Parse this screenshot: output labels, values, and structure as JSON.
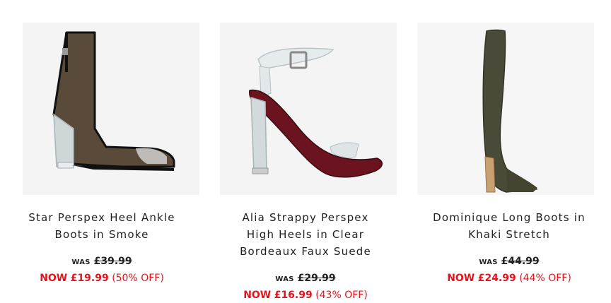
{
  "products": [
    {
      "title": "Star Perspex Heel Ankle Boots in Smoke",
      "was_label": "WAS",
      "was_price": "£39.99",
      "now_label": "NOW",
      "now_price": "£19.99",
      "discount": "(50% OFF)",
      "image_icon": "smoke-perspex-ankle-boot"
    },
    {
      "title": "Alia Strappy Perspex High Heels in Clear Bordeaux Faux Suede",
      "was_label": "WAS",
      "was_price": "£29.99",
      "now_label": "NOW",
      "now_price": "£16.99",
      "discount": "(43% OFF)",
      "image_icon": "bordeaux-perspex-sandal-heel"
    },
    {
      "title": "Dominique Long Boots in Khaki Stretch",
      "was_label": "WAS",
      "was_price": "£44.99",
      "now_label": "NOW",
      "now_price": "£24.99",
      "discount": "(44% OFF)",
      "image_icon": "khaki-thigh-high-boot"
    }
  ],
  "colors": {
    "sale_red": "#e2151c",
    "text_dark": "#222222",
    "smoke": "#5a4a3a",
    "bordeaux": "#6b1420",
    "khaki": "#4a4a38"
  }
}
